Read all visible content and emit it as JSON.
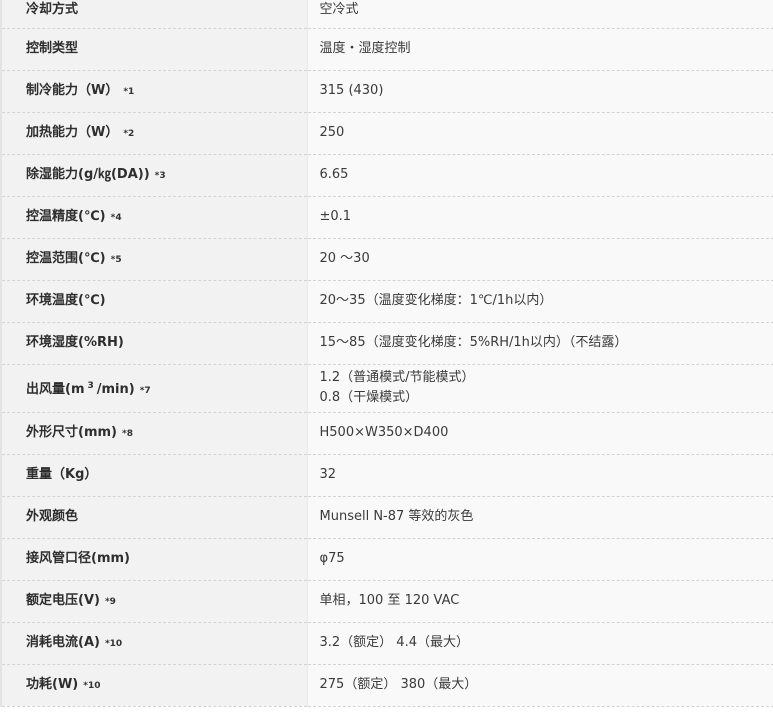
{
  "specs": [
    {
      "label": "冷却方式",
      "note": "",
      "value": "空冷式"
    },
    {
      "label": "控制类型",
      "note": "",
      "value": "温度・湿度控制"
    },
    {
      "label": "制冷能力（W）",
      "note": "*1",
      "value": "315 (430)"
    },
    {
      "label": "加热能力（W）",
      "note": "*2",
      "value": "250"
    },
    {
      "label": "除湿能力(g/㎏(DA))",
      "note": "*3",
      "value": "6.65"
    },
    {
      "label": "控温精度(℃)",
      "note": "*4",
      "value": "±0.1"
    },
    {
      "label": "控温范围(℃)",
      "note": "*5",
      "value": "20 ～30"
    },
    {
      "label": "环境温度(℃)",
      "note": "",
      "value": "20～35（温度变化梯度：1℃/1h以内）"
    },
    {
      "label": "环境湿度(%RH)",
      "note": "",
      "value": "15～85（湿度变化梯度：5%RH/1h以内）（不结露）"
    },
    {
      "label_pre": "出风量(m",
      "label_sup": "3",
      "label_post": "/min)",
      "note": "*7",
      "value_line1": "1.2（普通模式/节能模式）",
      "value_line2": "0.8（干燥模式）"
    },
    {
      "label": "外形尺寸(mm)",
      "note": "*8",
      "value": "H500×W350×D400"
    },
    {
      "label": "重量（Kg）",
      "note": "",
      "value": "32"
    },
    {
      "label": "外观颜色",
      "note": "",
      "value": "Munsell N-87 等效的灰色"
    },
    {
      "label": "接风管口径(mm)",
      "note": "",
      "value": "φ75"
    },
    {
      "label": "额定电压(V)",
      "note": "*9",
      "value": "单相，100 至 120 VAC"
    },
    {
      "label": "消耗电流(A)",
      "note": "*10",
      "value": "3.2（额定） 4.4（最大）"
    },
    {
      "label": "功耗(W)",
      "note": "*10",
      "value": "275（额定） 380（最大）"
    }
  ]
}
